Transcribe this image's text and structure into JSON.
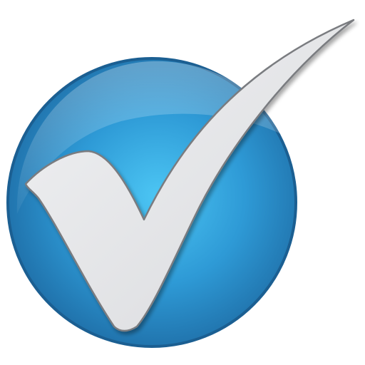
{
  "icon": {
    "name": "checkmark-badge-icon",
    "colors": {
      "background": "#ffffff",
      "disc_light": "#4cc6f4",
      "disc_mid": "#2e9ad6",
      "disc_dark": "#1f6fa8",
      "disc_rim": "#1b5f92",
      "check_fill": "#e3e4e6",
      "check_outline": "#7a7c80"
    }
  }
}
